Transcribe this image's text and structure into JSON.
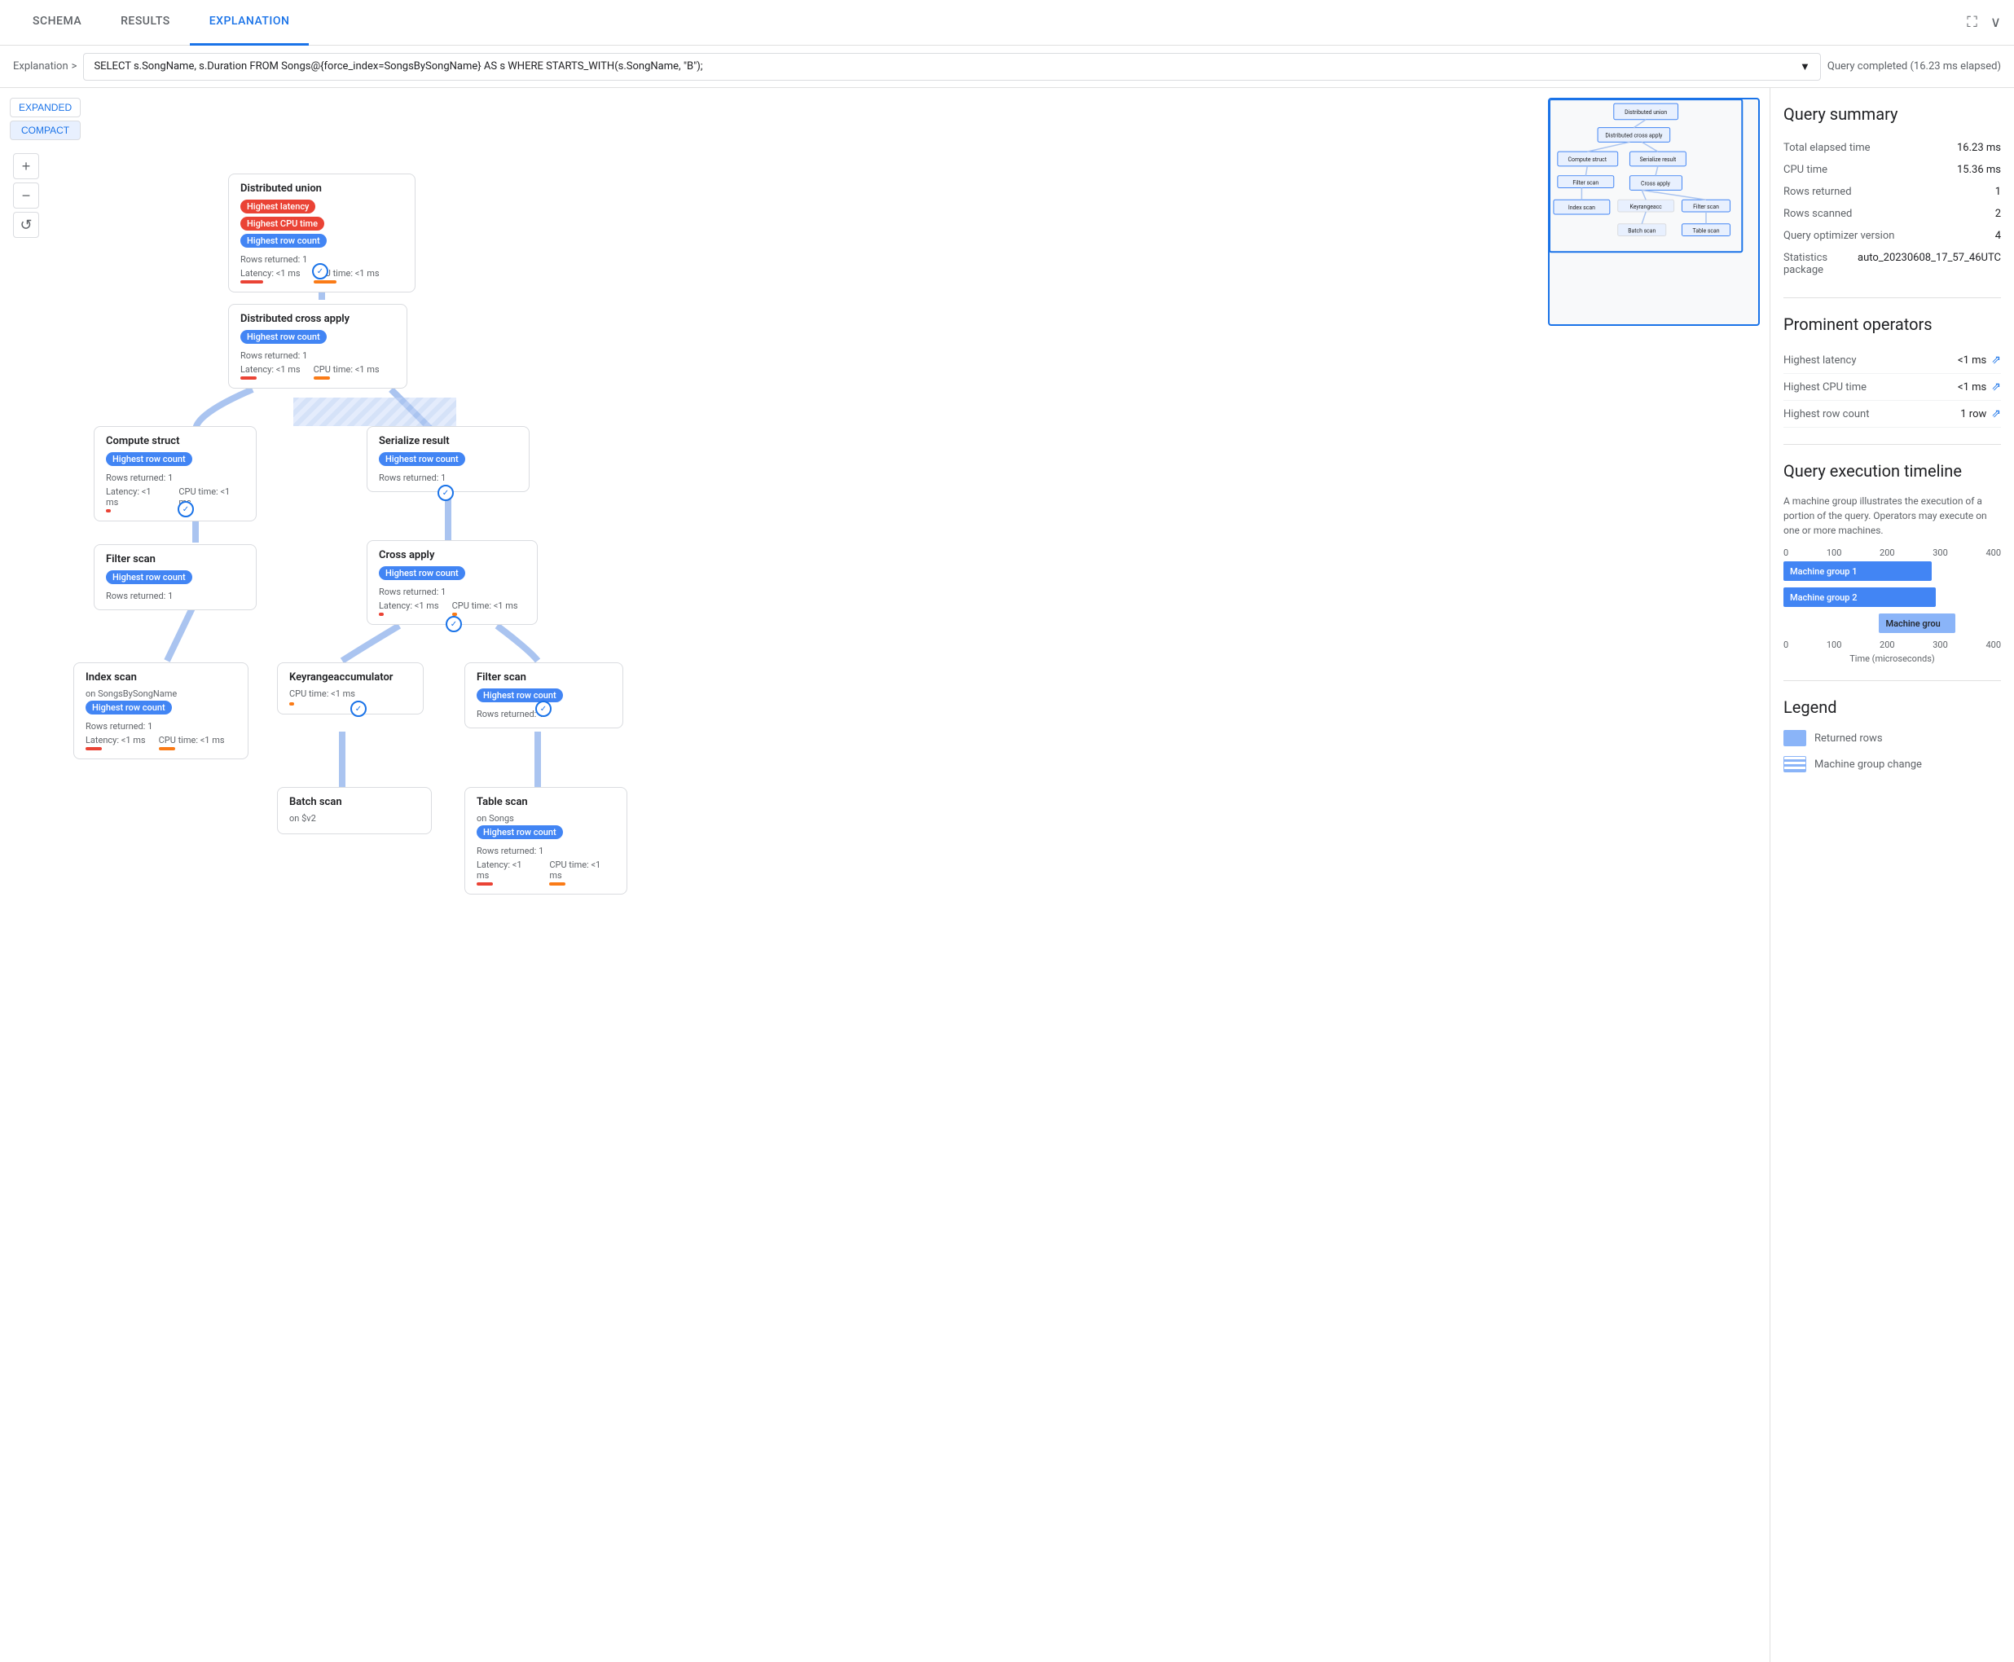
{
  "tabs": [
    {
      "id": "schema",
      "label": "SCHEMA",
      "active": false
    },
    {
      "id": "results",
      "label": "RESULTS",
      "active": false
    },
    {
      "id": "explanation",
      "label": "EXPLANATION",
      "active": true
    }
  ],
  "breadcrumb": {
    "label": "Explanation",
    "arrow": ">"
  },
  "query": {
    "text": "SELECT s.SongName, s.Duration FROM Songs@{force_index=SongsBySongName} AS s WHERE STARTS_WITH(s.SongName, \"B\");",
    "status": "Query completed (16.23 ms elapsed)"
  },
  "view_buttons": [
    {
      "label": "EXPANDED",
      "active": false
    },
    {
      "label": "COMPACT",
      "active": true
    }
  ],
  "zoom": {
    "plus": "+",
    "minus": "−",
    "reset": "↺"
  },
  "nodes": {
    "distributed_union": {
      "title": "Distributed union",
      "badges": [
        "Highest latency",
        "Highest CPU time",
        "Highest row count"
      ],
      "rows_returned": "Rows returned: 1",
      "latency": "Latency: <1 ms",
      "cpu_time": "CPU time: <1 ms"
    },
    "distributed_cross_apply": {
      "title": "Distributed cross apply",
      "badges": [
        "Highest row count"
      ],
      "rows_returned": "Rows returned: 1",
      "latency": "Latency: <1 ms",
      "cpu_time": "CPU time: <1 ms"
    },
    "compute_struct": {
      "title": "Compute struct",
      "badges": [
        "Highest row count"
      ],
      "rows_returned": "Rows returned: 1",
      "latency": "Latency: <1 ms",
      "cpu_time": "CPU time: <1 ms"
    },
    "serialize_result": {
      "title": "Serialize result",
      "badges": [
        "Highest row count"
      ],
      "rows_returned": "Rows returned: 1"
    },
    "filter_scan_top": {
      "title": "Filter scan",
      "badges": [
        "Highest row count"
      ],
      "rows_returned": "Rows returned: 1"
    },
    "cross_apply": {
      "title": "Cross apply",
      "badges": [
        "Highest row count"
      ],
      "rows_returned": "Rows returned: 1",
      "latency": "Latency: <1 ms",
      "cpu_time": "CPU time: <1 ms"
    },
    "index_scan": {
      "title": "Index scan",
      "subtitle": "on SongsBySongName",
      "badges": [
        "Highest row count"
      ],
      "rows_returned": "Rows returned: 1",
      "latency": "Latency: <1 ms",
      "cpu_time": "CPU time: <1 ms"
    },
    "keyrange_accumulator": {
      "title": "Keyrangeaccumulator",
      "cpu_time": "CPU time: <1 ms"
    },
    "filter_scan_bottom": {
      "title": "Filter scan",
      "badges": [
        "Highest row count"
      ],
      "rows_returned": "Rows returned: 1"
    },
    "batch_scan": {
      "title": "Batch scan",
      "subtitle": "on $v2"
    },
    "table_scan": {
      "title": "Table scan",
      "subtitle": "on Songs",
      "badges": [
        "Highest row count"
      ],
      "rows_returned": "Rows returned: 1",
      "latency": "Latency: <1 ms",
      "cpu_time": "CPU time: <1 ms"
    }
  },
  "query_summary": {
    "title": "Query summary",
    "stats": [
      {
        "label": "Total elapsed time",
        "value": "16.23 ms"
      },
      {
        "label": "CPU time",
        "value": "15.36 ms"
      },
      {
        "label": "Rows returned",
        "value": "1"
      },
      {
        "label": "Rows scanned",
        "value": "2"
      },
      {
        "label": "Query optimizer version",
        "value": "4"
      },
      {
        "label": "Statistics package",
        "value": "auto_20230608_17_57_46UTC"
      }
    ]
  },
  "prominent_operators": {
    "title": "Prominent operators",
    "items": [
      {
        "label": "Highest latency",
        "value": "<1 ms"
      },
      {
        "label": "Highest CPU time",
        "value": "<1 ms"
      },
      {
        "label": "Highest row count",
        "value": "1 row"
      }
    ]
  },
  "query_execution_timeline": {
    "title": "Query execution timeline",
    "description": "A machine group illustrates the execution of a portion of the query.\nOperators may execute on one or more machines.",
    "axis_labels": [
      "0",
      "100",
      "200",
      "300",
      "400"
    ],
    "bars": [
      {
        "label": "Machine group 1",
        "width_pct": 68,
        "type": "solid"
      },
      {
        "label": "Machine group 2",
        "width_pct": 70,
        "type": "solid"
      },
      {
        "label": "Machine grou",
        "width_pct": 35,
        "offset_pct": 44,
        "type": "partial"
      }
    ],
    "axis_unit": "Time (microseconds)"
  },
  "legend": {
    "title": "Legend",
    "items": [
      {
        "label": "Returned rows",
        "type": "solid"
      },
      {
        "label": "Machine group change",
        "type": "striped"
      }
    ]
  }
}
